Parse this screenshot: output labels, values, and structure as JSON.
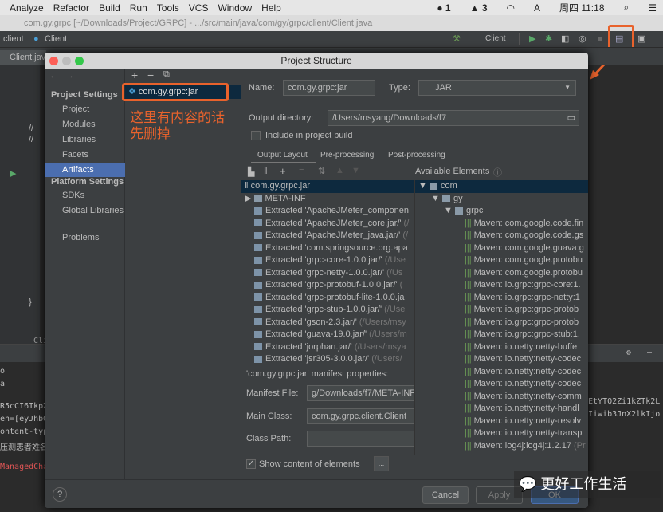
{
  "menubar": {
    "items": [
      "Analyze",
      "Refactor",
      "Build",
      "Run",
      "Tools",
      "VCS",
      "Window",
      "Help"
    ],
    "status": [
      "1",
      "3"
    ],
    "clock": "周四 11:18"
  },
  "window_title": "com.gy.grpc [~/Downloads/Project/GRPC] - .../src/main/java/com/gy/grpc/client/Client.java",
  "breadcrumb": [
    "client",
    "Client"
  ],
  "run_config": "Client",
  "editor_tab": "Client.java",
  "gutter_lines": [
    "//",
    "//",
    "}"
  ],
  "console": {
    "tab": "Cli",
    "left_lines": [
      "o",
      "a",
      "R5cCI6IkpX",
      "en=[eyJhbG",
      "ontent-typ",
      "压测患者姓名",
      "ManagedCha"
    ],
    "right_lines": [
      "EtYTQ2Zi1kZTk2L",
      "Iiwib3JnX2lkIjo"
    ]
  },
  "dialog": {
    "title": "Project Structure",
    "sidebar": {
      "project_settings": "Project Settings",
      "items": [
        "Project",
        "Modules",
        "Libraries",
        "Facets",
        "Artifacts"
      ],
      "selected": "Artifacts",
      "platform_settings": "Platform Settings",
      "platform_items": [
        "SDKs",
        "Global Libraries"
      ],
      "problems": "Problems"
    },
    "artifacts": {
      "toolbar": [
        "+",
        "−",
        "⧉"
      ],
      "items": [
        "com.gy.grpc:jar"
      ]
    },
    "annotation": "这里有内容的话\n先删掉",
    "name_label": "Name:",
    "name_value": "com.gy.grpc:jar",
    "type_label": "Type:",
    "type_value": "JAR",
    "output_dir_label": "Output directory:",
    "output_dir_value": "/Users/msyang/Downloads/f7",
    "include_label": "Include in project build",
    "include_checked": false,
    "tabs": [
      "Output Layout",
      "Pre-processing",
      "Post-processing"
    ],
    "active_tab": "Output Layout",
    "available_label": "Available Elements",
    "layout_root": "com.gy.grpc.jar",
    "layout_items": [
      {
        "name": "META-INF",
        "path": "",
        "folder": true
      },
      {
        "name": "Extracted 'ApacheJMeter_componen",
        "path": ""
      },
      {
        "name": "Extracted 'ApacheJMeter_core.jar/'",
        "path": " (/"
      },
      {
        "name": "Extracted 'ApacheJMeter_java.jar/'",
        "path": " (/"
      },
      {
        "name": "Extracted 'com.springsource.org.apa",
        "path": ""
      },
      {
        "name": "Extracted 'grpc-core-1.0.0.jar/'",
        "path": " (/Use"
      },
      {
        "name": "Extracted 'grpc-netty-1.0.0.jar/'",
        "path": " (/Us"
      },
      {
        "name": "Extracted 'grpc-protobuf-1.0.0.jar/'",
        "path": " ("
      },
      {
        "name": "Extracted 'grpc-protobuf-lite-1.0.0.ja",
        "path": ""
      },
      {
        "name": "Extracted 'grpc-stub-1.0.0.jar/'",
        "path": " (/Use"
      },
      {
        "name": "Extracted 'gson-2.3.jar/'",
        "path": " (/Users/msy"
      },
      {
        "name": "Extracted 'guava-19.0.jar/'",
        "path": " (/Users/m"
      },
      {
        "name": "Extracted 'jorphan.jar/'",
        "path": " (/Users/msya"
      },
      {
        "name": "Extracted 'jsr305-3.0.0.jar/'",
        "path": " (/Users/"
      }
    ],
    "available_tree": [
      "com",
      "gy",
      "grpc"
    ],
    "available_items": [
      "Maven: com.google.code.fin",
      "Maven: com.google.code.gs",
      "Maven: com.google.guava:g",
      "Maven: com.google.protobu",
      "Maven: com.google.protobu",
      "Maven: io.grpc:grpc-core:1.",
      "Maven: io.grpc:grpc-netty:1",
      "Maven: io.grpc:grpc-protob",
      "Maven: io.grpc:grpc-protob",
      "Maven: io.grpc:grpc-stub:1.",
      "Maven: io.netty:netty-buffe",
      "Maven: io.netty:netty-codec",
      "Maven: io.netty:netty-codec",
      "Maven: io.netty:netty-codec",
      "Maven: io.netty:netty-comm",
      "Maven: io.netty:netty-handl",
      "Maven: io.netty:netty-resolv",
      "Maven: io.netty:netty-transp",
      "Maven: log4j:log4j:1.2.17"
    ],
    "available_last_suffix": " (Pr",
    "manifest_header": "'com.gy.grpc.jar' manifest properties:",
    "manifest_file_label": "Manifest File:",
    "manifest_file_value": "g/Downloads/f7/META-INF",
    "main_class_label": "Main Class:",
    "main_class_value": "com.gy.grpc.client.Client",
    "class_path_label": "Class Path:",
    "class_path_value": "",
    "show_content_label": "Show content of elements",
    "show_content_checked": true,
    "more_button": "...",
    "help": "?",
    "cancel": "Cancel",
    "apply": "Apply",
    "ok": "OK"
  },
  "watermark": "更好工作生活",
  "colors": {
    "accent": "#4b6eaf",
    "annotation": "#e8622c"
  }
}
